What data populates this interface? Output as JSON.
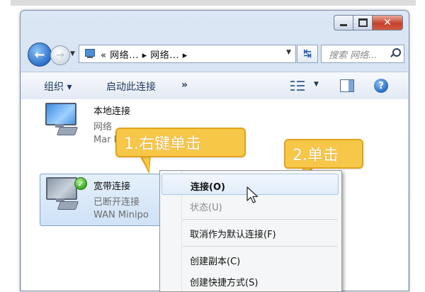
{
  "window": {
    "breadcrumb": "«  网络...  ▸  网络...  ▸",
    "search_placeholder": "搜索 网络..."
  },
  "toolbar": {
    "organize": "组织 ▾",
    "start_connection": "启动此连接",
    "more": "»"
  },
  "connections": {
    "local": {
      "name": "本地连接",
      "status": "网络",
      "device": "Mar                                                  l-E ..."
    },
    "broadband": {
      "name": "宽带连接",
      "status": "已断开连接",
      "device": "WAN Minipo"
    }
  },
  "callouts": {
    "step1": "1.右键单击",
    "step2": "2.单击"
  },
  "context_menu": {
    "items": [
      {
        "label": "连接(O)"
      },
      {
        "label": "状态(U)"
      },
      {
        "label": "取消作为默认连接(F)"
      },
      {
        "label": "创建副本(C)"
      },
      {
        "label": "创建快捷方式(S)"
      }
    ]
  },
  "colors": {
    "callout_fill": "#f7c748",
    "callout_border": "#e2a21c",
    "selection": "#cfe2f7"
  }
}
